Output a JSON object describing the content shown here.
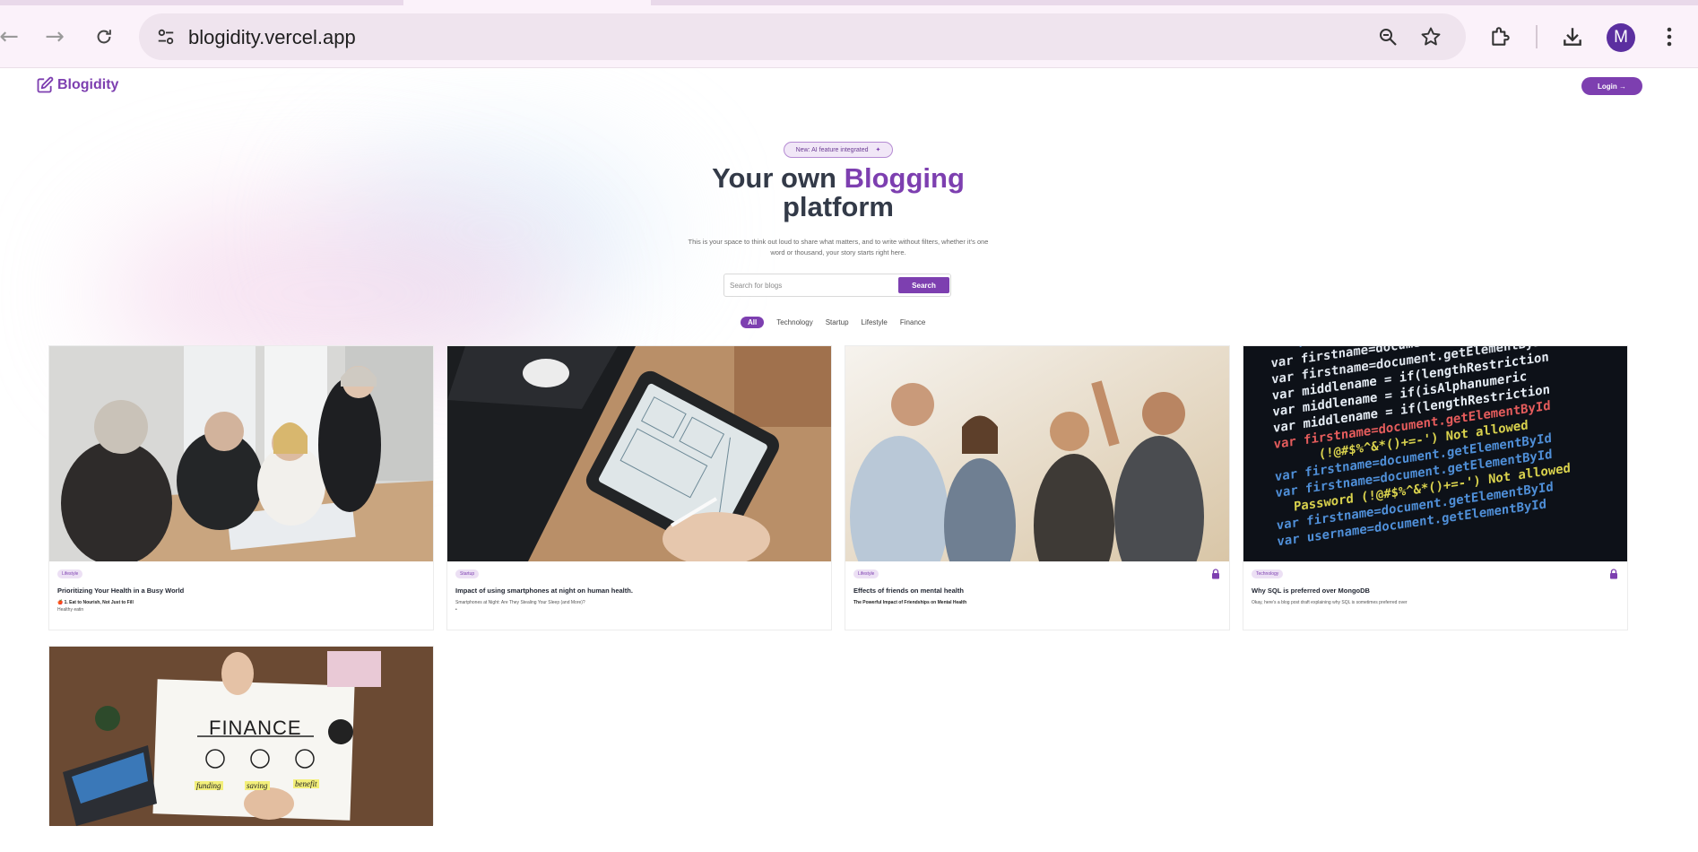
{
  "browser": {
    "url": "blogidity.vercel.app",
    "profile_initial": "M",
    "icons": {
      "back": "back-arrow-icon",
      "forward": "forward-arrow-icon",
      "reload": "reload-icon",
      "site_info": "site-settings-icon",
      "zoom": "zoom-icon",
      "bookmark": "star-icon",
      "extensions": "puzzle-icon",
      "downloads": "download-icon",
      "menu": "kebab-menu-icon"
    }
  },
  "site": {
    "brand": "Blogidity",
    "login_label": "Login →",
    "accent_color": "#7d3fb0"
  },
  "hero": {
    "badge": "New: AI feature integrated",
    "headline_part1": "Your own ",
    "headline_accent": "Blogging",
    "headline_part2": "platform",
    "subtext": "This is your space to think out loud to share what matters, and to write without filters, whether it's one word or thousand, your story starts right here."
  },
  "search": {
    "placeholder": "Search for blogs",
    "button_label": "Search"
  },
  "categories": [
    "All",
    "Technology",
    "Startup",
    "Lifestyle",
    "Finance"
  ],
  "active_category": "All",
  "posts": [
    {
      "tag": "Lifestyle",
      "title": "Prioritizing Your Health in a Busy World",
      "excerpt_line1": "🍎 1. Eat to Nourish, Not Just to Fill",
      "excerpt_line2": "Healthy eatin",
      "locked": false
    },
    {
      "tag": "Startup",
      "title": "Impact of using smartphones at night on human health.",
      "excerpt_line1": "Smartphones at Night: Are They Stealing Your Sleep (and More)?",
      "excerpt_line2": "•",
      "locked": false
    },
    {
      "tag": "Lifestyle",
      "title": "Effects of friends on mental health",
      "excerpt_line1": "The Powerful Impact of Friendships on Mental Health",
      "excerpt_line2": "",
      "locked": true
    },
    {
      "tag": "Technology",
      "title": "Why SQL is preferred over MongoDB",
      "excerpt_line1": "Okay, here's a blog post draft explaining why SQL is sometimes preferred over",
      "excerpt_line2": "",
      "locked": true
    }
  ],
  "finance_image_text": {
    "heading": "FINANCE",
    "label1": "funding",
    "label2": "saving",
    "label3": "benefit"
  },
  "code_image_lines": [
    "firstname=document.getElementById",
    "var  firstname=document.getElementById",
    "var  firstname=document.getElementById",
    "var  middlename = if(lengthRestriction",
    "var  middlename = if(isAlphanumeric",
    "var  middlename = if(lengthRestriction",
    "var  firstname=document.getElementById",
    "(!@#$%^&*()+=-') Not allowed",
    "var  firstname=document.getElementById",
    "var  firstname=document.getElementById",
    "Password (!@#$%^&*()+=-') Not allowed",
    "var  firstname=document.getElementById",
    "var  username=document.getElementById"
  ]
}
